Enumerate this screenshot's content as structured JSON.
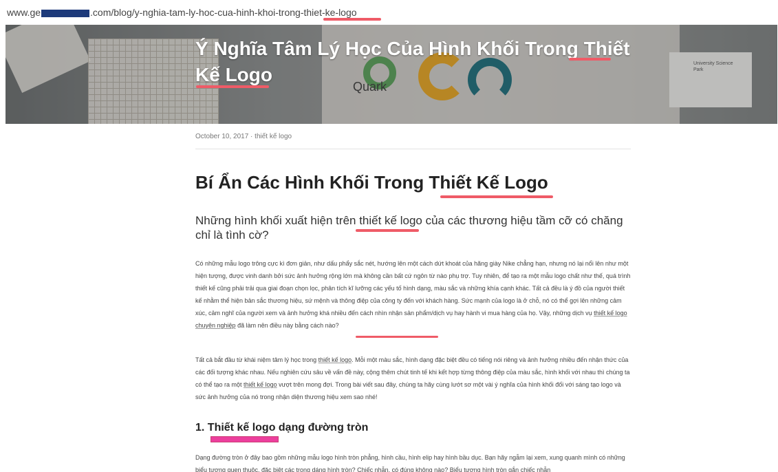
{
  "browser": {
    "url_prefix": "www.ge",
    "url_suffix": ".com/blog/y-nghia-tam-ly-hoc-cua-hinh-khoi-trong-",
    "url_highlight": "thiet-ke-logo"
  },
  "hero": {
    "title_line1": "Ý Nghĩa Tâm Lý Học Của Hình Khối Trong Thiết",
    "title_line2": "Kế Logo",
    "quark_label": "Quark",
    "card_text": "University Science Park"
  },
  "post": {
    "meta": "October 10, 2017 · thiết kế logo",
    "heading": "Bí Ẩn Các Hình Khối Trong Thiết Kế Logo",
    "lead": "Những hình khối xuất hiện trên thiết kế logo của các thương hiệu tầm cỡ có chăng chỉ là tình cờ?",
    "para1_a": "Có những mẫu logo trông cực kì đơn giản, như dấu phẩy sắc nét, hướng lên một cách dứt khoát của hãng giày Nike chẳng hạn, nhưng nó lại nổi lên như một hiện tượng, được vinh danh bởi sức ảnh hưởng rộng lớn mà không cần bất cứ ngôn từ nào phụ trợ. Tuy nhiên, để tạo ra một mẫu logo chất như thế, quá trình thiết kế cũng phải trải qua giai đoạn chọn lọc, phân tích kĩ lưỡng các yếu tố hình dạng, màu sắc và những khía cạnh khác. Tất cả đều là ý đồ của người thiết kế nhằm thể hiện bản sắc thương hiệu, sứ mệnh và thông điệp của công ty đến với khách hàng. Sức mạnh của logo là ở chỗ, nó có thể gợi lên những cảm xúc, cảm nghĩ của người xem và ảnh hưởng khá nhiều đến cách nhìn nhận sản phẩm/dịch vụ hay hành vi mua hàng của họ. Vậy, những dịch vụ ",
    "para1_link": "thiết kế logo chuyên nghiệp",
    "para1_b": " đã làm nên điều này bằng cách nào?",
    "para2_a": "Tất cả bắt đầu từ khái niệm tâm lý học trong ",
    "para2_link1": "thiết kế logo",
    "para2_b": ". Mỗi một màu sắc, hình dạng đặc biệt đều có tiếng nói riêng và ảnh hưởng nhiều đến nhận thức của các đối tượng khác nhau. Nếu nghiên cứu sâu về vấn đề này, cộng thêm chút tinh tế khi kết hợp từng thông điệp của màu sắc, hình khối với nhau thì chúng ta có thể tạo ra một ",
    "para2_link2": "thiết kế logo",
    "para2_c": " vượt trên mong đợi. Trong bài viết sau đây, chúng ta hãy cùng lướt sơ một vài ý nghĩa của hình khối đối với sáng tạo logo và sức ảnh hưởng của nó trong nhận diện thương hiệu xem sao nhé!",
    "section1_title": "1. Thiết kế logo dạng đường tròn",
    "para3": "Dạng đường tròn ở đây bao gồm những mẫu logo hình tròn phẳng, hình cầu, hình elip hay hình bầu dục. Bạn hãy ngẫm lại xem, xung quanh mình có những biểu tượng quen thuộc, đặc biệt các trong dáng hình tròn? Chiếc nhẫn, có đúng không nào? Biểu tượng hình tròn gắn chiếc nhẫn"
  },
  "colors": {
    "annotation_red": "#ef5b67",
    "annotation_magenta": "#e91e8c"
  }
}
